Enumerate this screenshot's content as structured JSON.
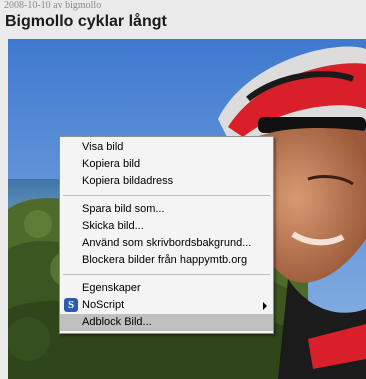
{
  "post": {
    "meta": "2008-10-10 av bigmollo",
    "title": "Bigmollo cyklar långt"
  },
  "context_menu": {
    "group1": [
      "Visa bild",
      "Kopiera bild",
      "Kopiera bildadress"
    ],
    "group2": [
      "Spara bild som...",
      "Skicka bild...",
      "Använd som skrivbordsbakgrund...",
      "Blockera bilder från happymtb.org"
    ],
    "group3": [
      "Egenskaper",
      "NoScript",
      "Adblock Bild..."
    ],
    "noscript_icon_letter": "S",
    "highlighted_item": "Adblock Bild..."
  },
  "colors": {
    "sky": "#5b8fd3",
    "accent_red": "#d81f2a",
    "highlight": "#c0c0c0"
  }
}
